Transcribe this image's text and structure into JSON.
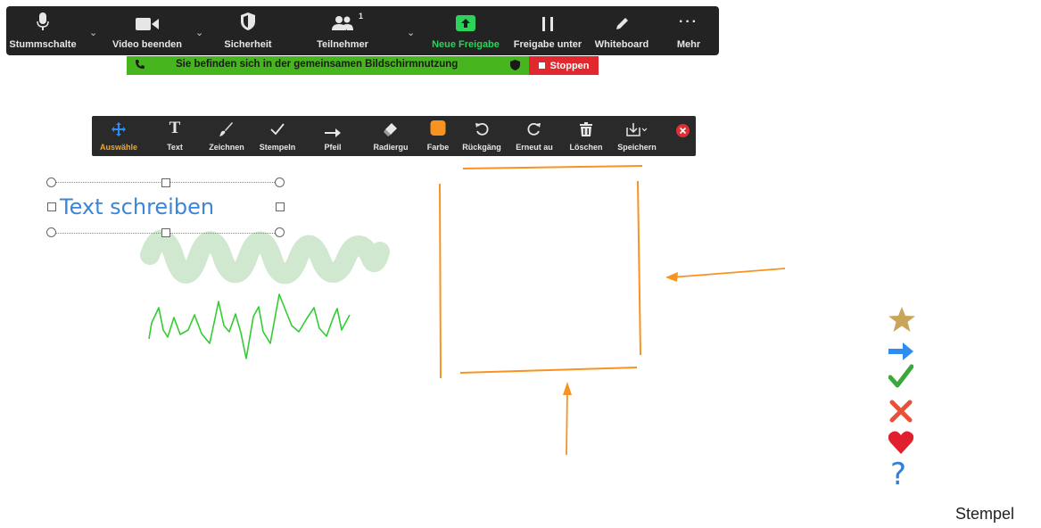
{
  "meeting_toolbar": {
    "mute": "Stummschalte",
    "video": "Video beenden",
    "security": "Sicherheit",
    "participants": "Teilnehmer",
    "participants_count": "1",
    "new_share": "Neue Freigabe",
    "pause_share": "Freigabe unter",
    "whiteboard": "Whiteboard",
    "more": "Mehr"
  },
  "share_banner": {
    "message": "Sie befinden sich in der gemeinsamen Bildschirmnutzung",
    "stop": "Stoppen"
  },
  "annotation_toolbar": {
    "select": "Auswähle",
    "text": "Text",
    "draw": "Zeichnen",
    "stamp": "Stempeln",
    "arrow": "Pfeil",
    "eraser": "Radiergu",
    "color": "Farbe",
    "undo": "Rückgäng",
    "redo": "Erneut au",
    "delete": "Löschen",
    "save": "Speichern"
  },
  "canvas": {
    "text_box": "Text schreiben",
    "stamps_caption": "Stempel",
    "stamp_icons": [
      "star-icon",
      "arrow-right-icon",
      "check-icon",
      "x-icon",
      "heart-icon",
      "question-icon"
    ],
    "colors": {
      "accent_orange": "#f7931e",
      "highlighter_green": "#cfe8cf",
      "pen_green": "#33cc33",
      "text_blue": "#3a86d8",
      "active_green": "#2bd35a",
      "banner_green": "#46b51e",
      "stop_red": "#e0282e"
    }
  }
}
